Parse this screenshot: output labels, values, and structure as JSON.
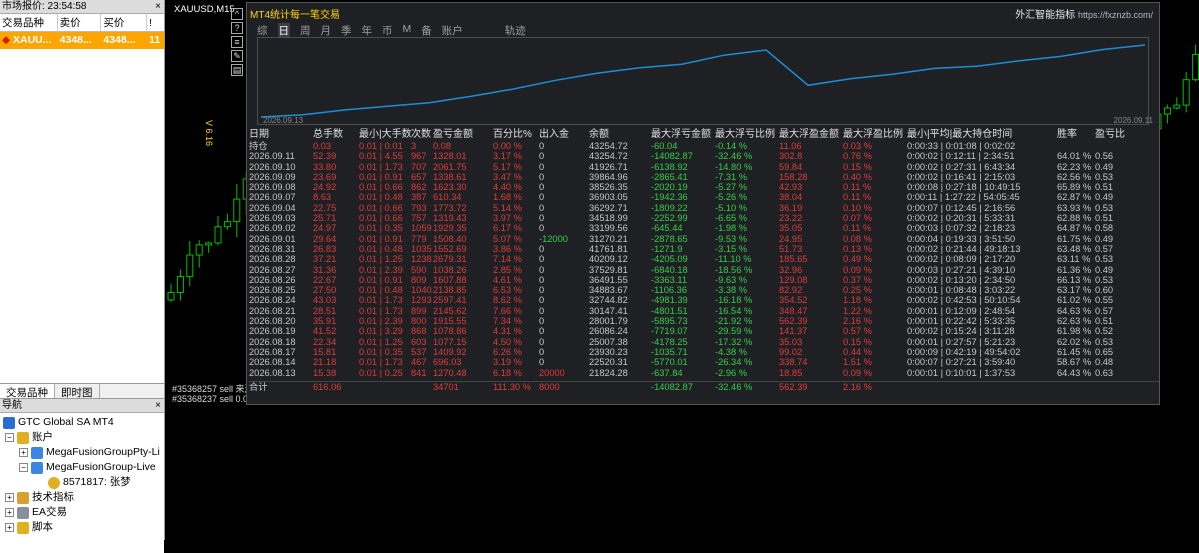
{
  "market_watch": {
    "title": "市场报价: 23:54:58",
    "close_glyph": "×",
    "headers": [
      "交易品种",
      "卖价",
      "买价",
      "!"
    ],
    "row": {
      "symbol": "XAUU...",
      "bid": "4348...",
      "ask": "4348...",
      "spread": "11"
    },
    "tabs": [
      "交易品种",
      "即时图"
    ]
  },
  "navigator": {
    "title": "导航",
    "close_glyph": "×",
    "items": [
      {
        "label": "GTC Global SA MT4",
        "icon": "mt4-icon"
      },
      {
        "label": "账户",
        "icon": "accounts-icon"
      },
      {
        "label": "MegaFusionGroupPty-Li",
        "icon": "server-icon"
      },
      {
        "label": "MegaFusionGroup-Live",
        "icon": "server-icon"
      },
      {
        "label": "8571817: 张梦",
        "icon": "user-icon"
      },
      {
        "label": "技术指标",
        "icon": "indicators-icon"
      },
      {
        "label": "EA交易",
        "icon": "expert-icon"
      },
      {
        "label": "脚本",
        "icon": "script-icon"
      }
    ]
  },
  "chart": {
    "title": "XAUUSD,M15",
    "side_label": "V 6.16",
    "tickets": [
      "#35368257 sell 来源:0",
      "#35368237 sell 0.01"
    ],
    "tool_icons": [
      "^",
      "?",
      "≡",
      "✎",
      "▤"
    ],
    "colors": {
      "bull": "#00c000",
      "bear": "#ffffff",
      "bg": "#000000"
    }
  },
  "stats": {
    "title": "MT4统计每一笔交易",
    "brand": "外汇智能指标",
    "brand_url": "https://fxznzb.com/",
    "tabs": [
      "综",
      "日",
      "周",
      "月",
      "季",
      "年",
      "币",
      "M",
      "备",
      "账户",
      "轨迹"
    ],
    "active_tab": 1,
    "equity_start": "2026.09.13",
    "equity_end": "2026.09.11",
    "headers": [
      "日期",
      "总手数",
      "最小|大手数",
      "次数",
      "盈亏金额",
      "百分比%",
      "出入金",
      "余额",
      "最大浮亏金额",
      "最大浮亏比例",
      "最大浮盈金额",
      "最大浮盈比例",
      "最小|平均|最大持仓时间",
      "胜率",
      "盈亏比"
    ],
    "rows": [
      [
        "持仓",
        "0.03",
        "0.01 | 0.01",
        "3",
        "0.08",
        "0.00 %",
        "0",
        "43254.72",
        "-60.04",
        "-0.14 %",
        "11.06",
        "0.03 %",
        "0:00:33 | 0:01:08 | 0:02:02",
        "",
        ""
      ],
      [
        "2026.09.11",
        "52.39",
        "0.01 | 4.55",
        "967",
        "1328.01",
        "3.17 %",
        "0",
        "43254.72",
        "-14082.87",
        "-32.46 %",
        "302.8",
        "0.76 %",
        "0:00:02 | 0:12:11 | 2:34:51",
        "64.01 %",
        "0.56"
      ],
      [
        "2026.09.10",
        "33.80",
        "0.01 | 1.73",
        "707",
        "2061.75",
        "5.17 %",
        "0",
        "41926.71",
        "-6138.92",
        "-14.80 %",
        "59.84",
        "0.15 %",
        "0:00:02 | 0:27:31 | 6:43:34",
        "62.23 %",
        "0.49"
      ],
      [
        "2026.09.09",
        "23.69",
        "0.01 | 0.91",
        "657",
        "1338.61",
        "3.47 %",
        "0",
        "39864.96",
        "-2865.41",
        "-7.31 %",
        "158.28",
        "0.40 %",
        "0:00:02 | 0:16:41 | 2:15:03",
        "62.56 %",
        "0.53"
      ],
      [
        "2026.09.08",
        "24.92",
        "0.01 | 0.66",
        "862",
        "1623.30",
        "4.40 %",
        "0",
        "38526.35",
        "-2020.19",
        "-5.27 %",
        "42.93",
        "0.11 %",
        "0:00:08 | 0:27:18 | 10:49:15",
        "65.89 %",
        "0.51"
      ],
      [
        "2026.09.07",
        "8.63",
        "0.01 | 0.48",
        "387",
        "610.34",
        "1.68 %",
        "0",
        "36903.05",
        "-1942.36",
        "-5.26 %",
        "38.04",
        "0.11 %",
        "0:00:11 | 1:27:22 | 54:05:45",
        "62.87 %",
        "0.49"
      ],
      [
        "2026.09.04",
        "22.75",
        "0.01 | 0.66",
        "793",
        "1773.72",
        "5.14 %",
        "0",
        "36292.71",
        "-1809.22",
        "-5.10 %",
        "36.19",
        "0.10 %",
        "0:00:07 | 0:12:45 | 2:16:56",
        "63.93 %",
        "0.53"
      ],
      [
        "2026.09.03",
        "25.71",
        "0.01 | 0.66",
        "757",
        "1319.43",
        "3.97 %",
        "0",
        "34518.99",
        "-2252.99",
        "-6.65 %",
        "23.22",
        "0.07 %",
        "0:00:02 | 0:20:31 | 5:33:31",
        "62.88 %",
        "0.51"
      ],
      [
        "2026.09.02",
        "24.97",
        "0.01 | 0.35",
        "1059",
        "1929.35",
        "6.17 %",
        "0",
        "33199.56",
        "-645.44",
        "-1.98 %",
        "35.05",
        "0.11 %",
        "0:00:03 | 0:07:32 | 2:18:23",
        "64.87 %",
        "0.58"
      ],
      [
        "2026.09.01",
        "29.64",
        "0.01 | 0.91",
        "779",
        "1508.40",
        "5.07 %",
        "-12000",
        "31270.21",
        "-2878.65",
        "-9.53 %",
        "24.95",
        "0.08 %",
        "0:00:04 | 0:19:33 | 3:51:50",
        "61.75 %",
        "0.49"
      ],
      [
        "2026.08.31",
        "26.83",
        "0.01 | 0.48",
        "1035",
        "1552.69",
        "3.86 %",
        "0",
        "41761.81",
        "-1271.9",
        "-3.15 %",
        "51.73",
        "0.13 %",
        "0:00:02 | 0:21:44 | 49:18:13",
        "63.48 %",
        "0.57"
      ],
      [
        "2026.08.28",
        "37.21",
        "0.01 | 1.25",
        "1238",
        "2679.31",
        "7.14 %",
        "0",
        "40209.12",
        "-4205.09",
        "-11.10 %",
        "185.65",
        "0.49 %",
        "0:00:02 | 0:08:09 | 2:17:20",
        "63.11 %",
        "0.53"
      ],
      [
        "2026.08.27",
        "31.36",
        "0.01 | 2.39",
        "590",
        "1038.26",
        "2.85 %",
        "0",
        "37529.81",
        "-6840.18",
        "-18.56 %",
        "32.96",
        "0.09 %",
        "0:00:03 | 0:27:21 | 4:39:10",
        "61.36 %",
        "0.49"
      ],
      [
        "2026.08.26",
        "22.67",
        "0.01 | 0.91",
        "809",
        "1607.88",
        "4.61 %",
        "0",
        "36491.55",
        "-3363.11",
        "-9.63 %",
        "129.08",
        "0.37 %",
        "0:00:02 | 0:13:20 | 2:34:50",
        "66.13 %",
        "0.53"
      ],
      [
        "2026.08.25",
        "27.50",
        "0.01 | 0.48",
        "1040",
        "2138.85",
        "6.53 %",
        "0",
        "34883.67",
        "-1106.36",
        "-3.38 %",
        "82.92",
        "0.25 %",
        "0:00:01 | 0:08:48 | 3:03:22",
        "63.17 %",
        "0.60"
      ],
      [
        "2026.08.24",
        "43.03",
        "0.01 | 1.73",
        "1293",
        "2597.41",
        "8.62 %",
        "0",
        "32744.82",
        "-4981.39",
        "-16.18 %",
        "354.52",
        "1.18 %",
        "0:00:02 | 0:42:53 | 50:10:54",
        "61.02 %",
        "0.55"
      ],
      [
        "2026.08.21",
        "28.51",
        "0.01 | 1.73",
        "899",
        "2145.62",
        "7.66 %",
        "0",
        "30147.41",
        "-4801.51",
        "-16.54 %",
        "348.47",
        "1.22 %",
        "0:00:01 | 0:12:09 | 2:48:54",
        "64.63 %",
        "0.57"
      ],
      [
        "2026.08.20",
        "35.91",
        "0.01 | 2.39",
        "800",
        "1915.55",
        "7.34 %",
        "0",
        "28001.79",
        "-5895.73",
        "-21.92 %",
        "562.39",
        "2.16 %",
        "0:00:01 | 0:22:42 | 5:33:35",
        "62.63 %",
        "0.51"
      ],
      [
        "2026.08.19",
        "41.52",
        "0.01 | 3.29",
        "868",
        "1078.86",
        "4.31 %",
        "0",
        "26086.24",
        "-7719.07",
        "-29.59 %",
        "141.37",
        "0.57 %",
        "0:00:02 | 0:15:24 | 3:11:28",
        "61.98 %",
        "0.52"
      ],
      [
        "2026.08.18",
        "22.34",
        "0.01 | 1.25",
        "603",
        "1077.15",
        "4.50 %",
        "0",
        "25007.38",
        "-4178.25",
        "-17.32 %",
        "35.03",
        "0.15 %",
        "0:00:01 | 0:27:57 | 5:21:23",
        "62.02 %",
        "0.53"
      ],
      [
        "2026.08.17",
        "15.81",
        "0.01 | 0.35",
        "537",
        "1409.92",
        "6.26 %",
        "0",
        "23930.23",
        "-1035.71",
        "-4.38 %",
        "99.02",
        "0.44 %",
        "0:00:09 | 0:42:19 | 49:54:02",
        "61.45 %",
        "0.65"
      ],
      [
        "2026.08.14",
        "21.18",
        "0.01 | 1.73",
        "467",
        "696.03",
        "3.19 %",
        "0",
        "22520.31",
        "-5770.01",
        "-26.34 %",
        "338.74",
        "1.51 %",
        "0:00:07 | 0:27:21 | 3:59:40",
        "58.67 %",
        "0.48"
      ],
      [
        "2026.08.13",
        "15.38",
        "0.01 | 0.25",
        "841",
        "1270.48",
        "6.18 %",
        "20000",
        "21824.28",
        "-637.84",
        "-2.96 %",
        "18.85",
        "0.09 %",
        "0:00:01 | 0:10:01 | 1:37:53",
        "64.43 %",
        "0.63"
      ]
    ],
    "totals": [
      "合计",
      "616.06",
      "",
      "",
      "34701",
      "111.30 %",
      "8000",
      "",
      "-14082.87",
      "-32.46 %",
      "562.39",
      "2.16 %",
      "",
      "",
      ""
    ],
    "colors": {
      "profit": "#e23b3b",
      "loss": "#35d04a",
      "equity": "#1a8fd8"
    }
  }
}
